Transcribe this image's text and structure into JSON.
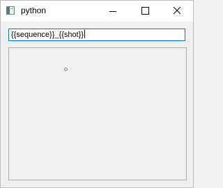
{
  "window": {
    "title": "python",
    "app_icon": "python-window-icon",
    "controls": {
      "minimize_icon": "minimize-icon",
      "maximize_icon": "maximize-icon",
      "close_icon": "close-icon"
    }
  },
  "main": {
    "template_input": {
      "value": "{{sequence}}_{{shot}}"
    }
  },
  "colors": {
    "titlebar": "#ffffff",
    "window_background": "#f0f0f0",
    "input_focus_border": "#0078d7",
    "panel_border": "#adadad"
  }
}
